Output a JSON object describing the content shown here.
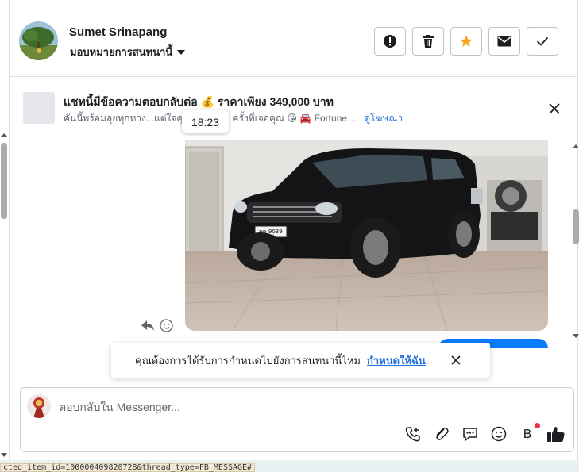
{
  "contact": {
    "name": "Sumet Srinapang",
    "assign_label": "มอบหมายการสนทนานี้"
  },
  "header_actions": [
    {
      "icon": "alert-icon",
      "label": "Mark as spam"
    },
    {
      "icon": "trash-icon",
      "label": "Delete"
    },
    {
      "icon": "star-icon",
      "label": "Follow up"
    },
    {
      "icon": "envelope-icon",
      "label": "Mark as unread"
    },
    {
      "icon": "check-icon",
      "label": "Move to done"
    }
  ],
  "ad": {
    "title": "แชทนี้มีข้อความตอบกลับต่อ 💰 ราคาเพียง 349,000 บาท",
    "subtitle": "คันนี้พร้อมลุยทุกทาง...แต่ใจคุ",
    "subtitle_tail": "ครั้งที่เจอคุณ 😘 🚘 Fortune…",
    "link": "ดูโฆษณา"
  },
  "tooltip_time": "18:23",
  "photo": {
    "plate_line1": "ษข 9039",
    "plate_line2": "ชลบุรี"
  },
  "toast": {
    "text": "คุณต้องการได้รับการกำหนดไปยังการสนทนานี้ไหม",
    "link": "กำหนดให้ฉัน"
  },
  "composer": {
    "placeholder": "ตอบกลับใน Messenger..."
  },
  "composer_tools": [
    "phone-add-icon",
    "paperclip-icon",
    "chat-bubble-icon",
    "emoji-icon",
    "baht-icon",
    "thumbs-up-icon"
  ],
  "status_bar": "cted_item_id=100000409820728&thread_type=FB_MESSAGE#",
  "colors": {
    "accent_blue": "#216fdb",
    "star_orange": "#f5a623",
    "notif_dot": "#f02849",
    "border": "#bec3c9"
  }
}
